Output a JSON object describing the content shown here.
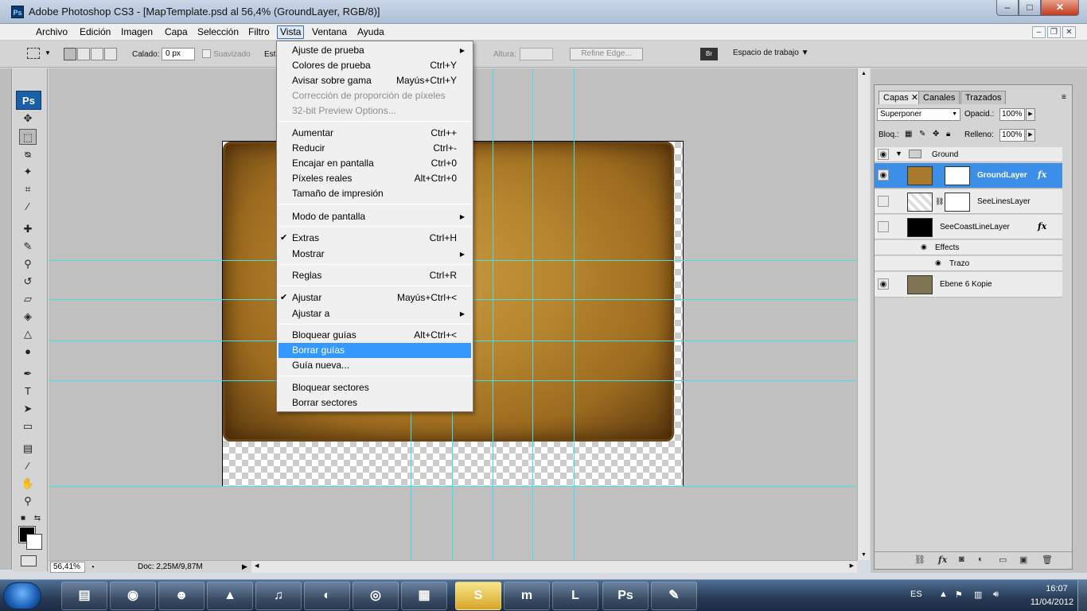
{
  "window": {
    "title": "Adobe Photoshop CS3 - [MapTemplate.psd al 56,4% (GroundLayer, RGB/8)]",
    "icon": "Ps",
    "minimize": "–",
    "maximize": "□",
    "close": "✕"
  },
  "menubar": [
    "Archivo",
    "Edición",
    "Imagen",
    "Capa",
    "Selección",
    "Filtro",
    "Vista",
    "Ventana",
    "Ayuda"
  ],
  "options": {
    "feather_label": "Calado:",
    "feather_value": "0 px",
    "antialias_label": "Suavizado",
    "style_label": "Est",
    "height_label": "Altura:",
    "refine_edge": "Refine Edge...",
    "workspace": "Espacio de trabajo ▼"
  },
  "vista_menu": [
    {
      "label": "Ajuste de prueba",
      "shortcut": "",
      "submenu": true
    },
    {
      "label": "Colores de prueba",
      "shortcut": "Ctrl+Y"
    },
    {
      "label": "Avisar sobre gama",
      "shortcut": "Mayús+Ctrl+Y"
    },
    {
      "label": "Corrección de proporción de píxeles",
      "shortcut": "",
      "disabled": true
    },
    {
      "label": "32-bit Preview Options...",
      "shortcut": "",
      "disabled": true
    },
    {
      "label": "Aumentar",
      "shortcut": "Ctrl++"
    },
    {
      "label": "Reducir",
      "shortcut": "Ctrl+-"
    },
    {
      "label": "Encajar en pantalla",
      "shortcut": "Ctrl+0"
    },
    {
      "label": "Píxeles reales",
      "shortcut": "Alt+Ctrl+0"
    },
    {
      "label": "Tamaño de impresión",
      "shortcut": ""
    },
    {
      "label": "Modo de pantalla",
      "shortcut": "",
      "submenu": true
    },
    {
      "label": "Extras",
      "shortcut": "Ctrl+H",
      "checked": true
    },
    {
      "label": "Mostrar",
      "shortcut": "",
      "submenu": true
    },
    {
      "label": "Reglas",
      "shortcut": "Ctrl+R"
    },
    {
      "label": "Ajustar",
      "shortcut": "Mayús+Ctrl+<",
      "checked": true
    },
    {
      "label": "Ajustar a",
      "shortcut": "",
      "submenu": true
    },
    {
      "label": "Bloquear guías",
      "shortcut": "Alt+Ctrl+<"
    },
    {
      "label": "Borrar guías",
      "shortcut": "",
      "highlighted": true
    },
    {
      "label": "Guía nueva...",
      "shortcut": ""
    },
    {
      "label": "Bloquear sectores",
      "shortcut": ""
    },
    {
      "label": "Borrar sectores",
      "shortcut": ""
    }
  ],
  "layers_panel": {
    "tabs": [
      "Capas",
      "Canales",
      "Trazados"
    ],
    "blend_mode": "Superponer",
    "opacity_label": "Opacid.:",
    "opacity_value": "100%",
    "lock_label": "Bloq.:",
    "fill_label": "Relleno:",
    "fill_value": "100%",
    "group_name": "Ground",
    "layers": [
      "GroundLayer",
      "SeeLinesLayer",
      "SeeCoastLineLayer",
      "Effects",
      "Trazo",
      "Ebene 6 Kopie"
    ],
    "fx": "fx"
  },
  "status": {
    "zoom": "56,41%",
    "doc": "Doc: 2,25M/9,87M"
  },
  "taskbar": {
    "lang": "ES",
    "time": "16:07",
    "date": "11/04/2012",
    "ps_label": "Ps"
  },
  "colors": {
    "accent": "#3399ff",
    "guide": "#3fe0ee",
    "selected_layer": "#3b8fe8"
  }
}
